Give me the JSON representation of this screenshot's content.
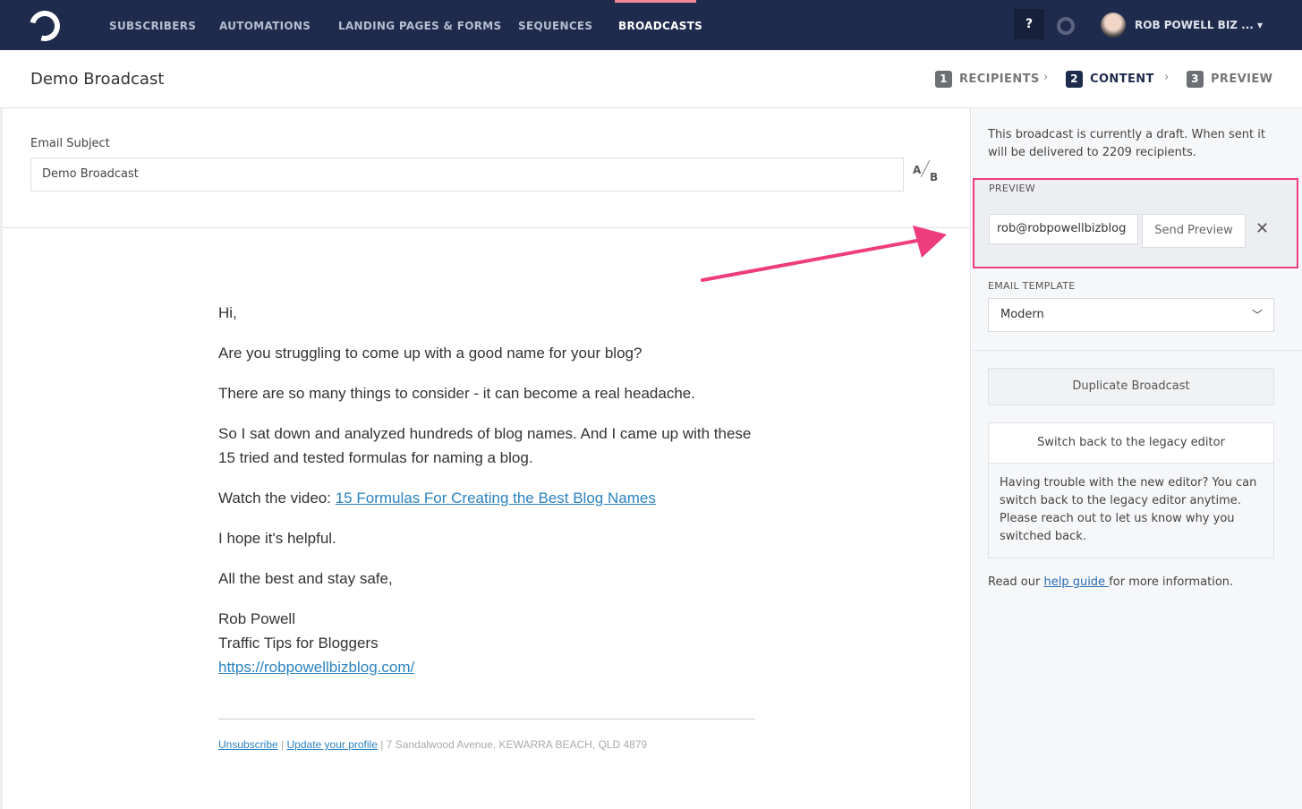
{
  "nav": {
    "items": [
      "SUBSCRIBERS",
      "AUTOMATIONS",
      "LANDING PAGES & FORMS",
      "SEQUENCES",
      "BROADCASTS"
    ],
    "active": "BROADCASTS",
    "help": "?",
    "user": "ROB POWELL BIZ ... ▾"
  },
  "header": {
    "title": "Demo Broadcast",
    "steps": [
      {
        "n": "1",
        "label": "RECIPIENTS"
      },
      {
        "n": "2",
        "label": "CONTENT"
      },
      {
        "n": "3",
        "label": "PREVIEW"
      }
    ]
  },
  "subject": {
    "label": "Email Subject",
    "value": "Demo Broadcast",
    "ab_a": "A",
    "ab_b": "B"
  },
  "email": {
    "p1": "Hi,",
    "p2": "Are you struggling to come up with a good name for your blog?",
    "p3": "There are so many things to consider - it can become a real headache.",
    "p4": "So I sat down and analyzed hundreds of blog names. And I came up with these 15 tried and tested formulas for naming a blog.",
    "p5_prefix": "Watch the video: ",
    "p5_link": "15 Formulas For Creating the Best Blog Names",
    "p6": "I hope it's helpful.",
    "p7": "All the best and stay safe,",
    "sig_name": "Rob Powell",
    "sig_company": "Traffic Tips for Bloggers",
    "sig_url": "https://robpowellbizblog.com/",
    "footer": {
      "unsubscribe": "Unsubscribe",
      "sep1": " | ",
      "update": "Update your profile",
      "address": " | 7 Sandalwood Avenue, KEWARRA BEACH, QLD 4879"
    }
  },
  "sidebar": {
    "note": "This broadcast is currently a draft. When sent it will be delivered to 2209 recipients.",
    "preview_label": "PREVIEW",
    "preview_email": "rob@robpowellbizblog",
    "send_preview": "Send Preview",
    "close": "✕",
    "template_label": "EMAIL TEMPLATE",
    "template_value": "Modern",
    "duplicate": "Duplicate Broadcast",
    "legacy_button": "Switch back to the legacy editor",
    "legacy_text": "Having trouble with the new editor? You can switch back to the legacy editor anytime. Please reach out to let us know why you switched back.",
    "guide_prefix": "Read our ",
    "guide_link": "help guide ",
    "guide_suffix": "for more information."
  },
  "colors": {
    "nav": "#1f2b4c",
    "highlight": "#ee3d7d",
    "link": "#2b82c0"
  }
}
